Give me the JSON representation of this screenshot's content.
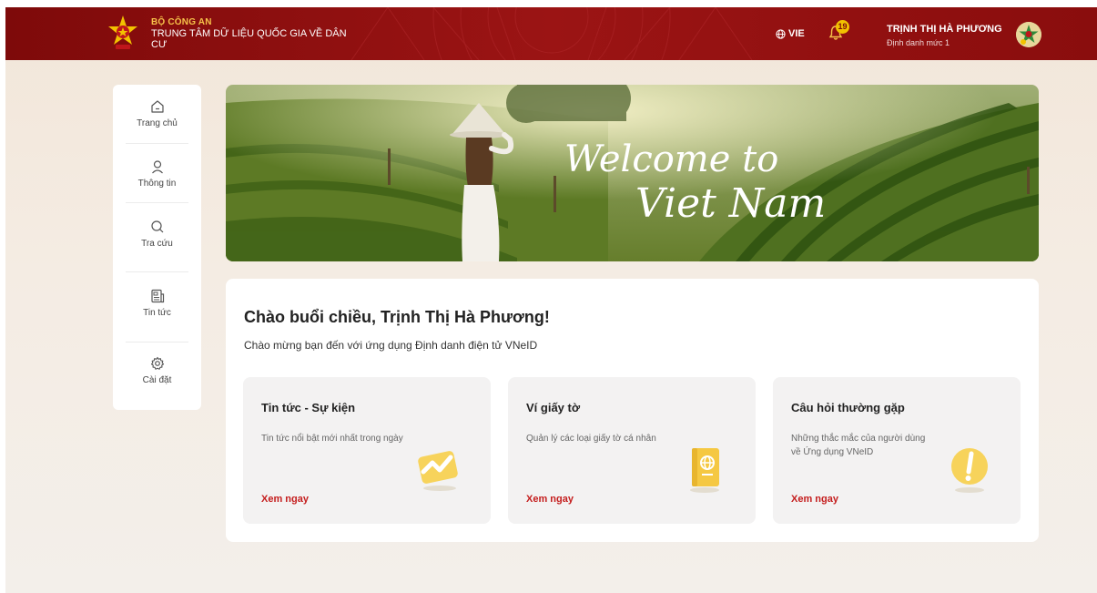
{
  "header": {
    "org_top": "BỘ CÔNG AN",
    "org_name": "TRUNG TÂM DỮ LIỆU QUỐC GIA VỀ DÂN CƯ",
    "language": "VIE",
    "notification_count": "19",
    "user_name": "TRỊNH THỊ HÀ PHƯƠNG",
    "user_level": "Định danh mức 1"
  },
  "sidebar": {
    "items": [
      {
        "label": "Trang chủ",
        "icon": "home-icon"
      },
      {
        "label": "Thông tin",
        "icon": "user-icon"
      },
      {
        "label": "Tra cứu",
        "icon": "search-icon"
      },
      {
        "label": "Tin tức",
        "icon": "news-icon"
      },
      {
        "label": "Cài đặt",
        "icon": "gear-icon"
      }
    ]
  },
  "banner": {
    "line1": "Welcome to",
    "line2": "Viet Nam"
  },
  "main": {
    "greeting": "Chào buổi chiều, Trịnh Thị Hà Phương!",
    "subgreeting": "Chào mừng bạn đến với ứng dụng Định danh điện tử VNeID",
    "features": [
      {
        "title": "Tin tức - Sự kiện",
        "desc": "Tin tức nổi bật mới nhất trong ngày",
        "link": "Xem ngay",
        "icon": "chart-icon"
      },
      {
        "title": "Ví giấy tờ",
        "desc": "Quản lý các loại giấy tờ cá nhân",
        "link": "Xem ngay",
        "icon": "passport-icon"
      },
      {
        "title": "Câu hỏi thường gặp",
        "desc": "Những thắc mắc của người dùng về Ứng dụng VNeID",
        "link": "Xem ngay",
        "icon": "exclamation-icon"
      }
    ]
  },
  "colors": {
    "header_red": "#8a0d0d",
    "accent_gold": "#f6c24a",
    "link_red": "#c41d1d"
  }
}
